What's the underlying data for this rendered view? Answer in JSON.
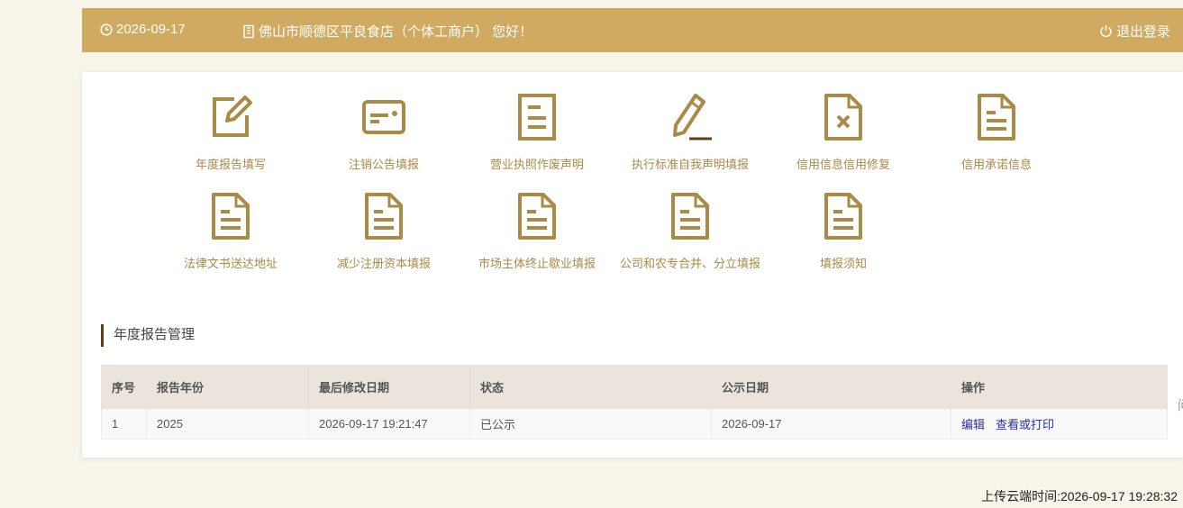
{
  "header": {
    "date": "2026-09-17",
    "greeting": "佛山市顺德区平良食店（个体工商户） 您好！",
    "logout_label": "退出登录"
  },
  "tiles": [
    {
      "label": "年度报告填写",
      "icon": "edit-icon"
    },
    {
      "label": "注销公告填报",
      "icon": "card-icon"
    },
    {
      "label": "营业执照作废声明",
      "icon": "document-icon"
    },
    {
      "label": "执行标准自我声明填报",
      "icon": "pencil-icon"
    },
    {
      "label": "信用信息信用修复",
      "icon": "document-x-icon"
    },
    {
      "label": "信用承诺信息",
      "icon": "document-lines-icon"
    },
    {
      "label": "法律文书送达地址",
      "icon": "document-lines-icon"
    },
    {
      "label": "减少注册资本填报",
      "icon": "document-lines-icon"
    },
    {
      "label": "市场主体终止歇业填报",
      "icon": "document-lines-icon"
    },
    {
      "label": "公司和农专合并、分立填报",
      "icon": "document-lines-icon"
    },
    {
      "label": "填报须知",
      "icon": "document-lines-icon"
    }
  ],
  "section": {
    "title": "年度报告管理"
  },
  "table": {
    "columns": [
      "序号",
      "报告年份",
      "最后修改日期",
      "状态",
      "公示日期",
      "操作"
    ],
    "rows": [
      {
        "index": "1",
        "year": "2025",
        "modified": "2026-09-17 19:21:47",
        "status": "已公示",
        "publish_date": "2026-09-17",
        "actions": [
          "编辑",
          "查看或打印"
        ]
      }
    ]
  },
  "side_char": "问",
  "footer": {
    "upload_time": "上传云端时间:2026-09-17 19:28:32"
  },
  "colors": {
    "header_bg": "#cfaa60",
    "icon": "#a98a47",
    "accent": "#5e3f14",
    "link": "#2b2bb5"
  }
}
